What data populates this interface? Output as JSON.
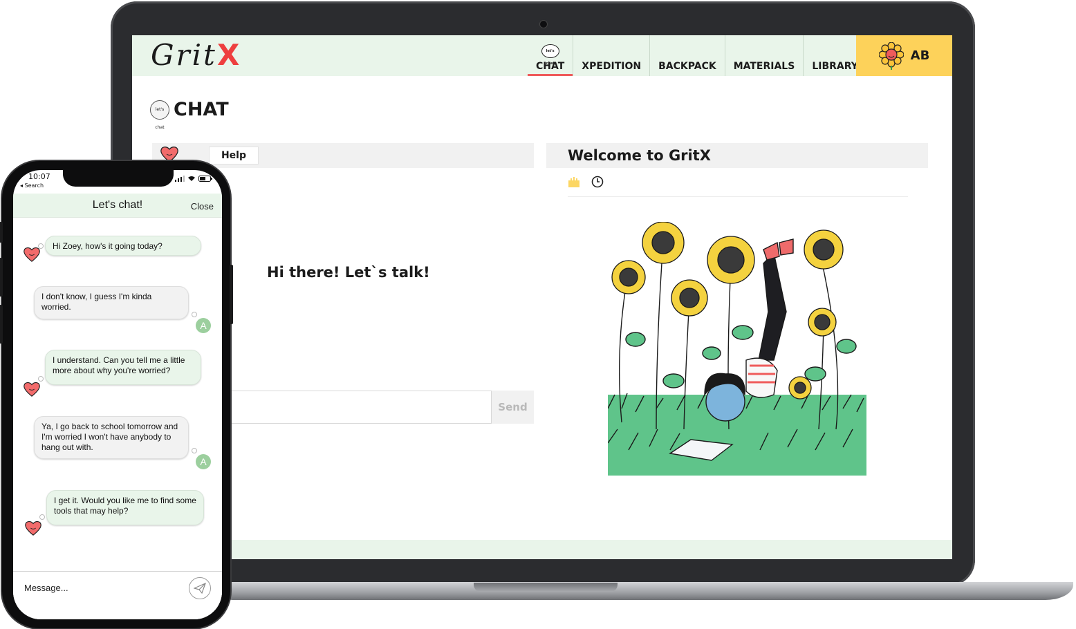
{
  "laptop": {
    "logo": {
      "text": "Grit",
      "accent": "X"
    },
    "nav": [
      {
        "label": "CHAT",
        "active": true
      },
      {
        "label": "XPEDITION",
        "active": false
      },
      {
        "label": "BACKPACK",
        "active": false
      },
      {
        "label": "MATERIALS",
        "active": false
      },
      {
        "label": "LIBRARY",
        "active": false
      }
    ],
    "nav_bubble_text": "let's chat",
    "user_initials": "AB",
    "page_title": "CHAT",
    "help_tab": "Help",
    "chat_greeting": "Hi there! Let`s talk!",
    "send_label": "Send",
    "welcome_title": "Welcome to GritX",
    "colors": {
      "header_bg": "#e9f5ea",
      "user_badge": "#fdd25a",
      "active_underline": "#ef5b5b",
      "logo_accent": "#ee3f3f"
    },
    "icons": [
      "flower-icon",
      "heart-icon",
      "clock-icon",
      "castle-icon",
      "speech-bubble-icon"
    ]
  },
  "phone": {
    "status_time": "10:07",
    "status_back": "◂ Search",
    "chat_title": "Let's chat!",
    "close_label": "Close",
    "messages": [
      {
        "from": "bot",
        "text": "Hi Zoey, how's it going today?"
      },
      {
        "from": "user",
        "text": "I don't know, I guess I'm kinda worried."
      },
      {
        "from": "bot",
        "text": "I understand. Can you tell me a little more about why you're worried?"
      },
      {
        "from": "user",
        "text": "Ya, I go back to school tomorrow and I'm worried I won't have anybody to hang out with."
      },
      {
        "from": "bot",
        "text": "I get it. Would you like me to find some tools that may help?"
      }
    ],
    "user_avatar_letter": "A",
    "composer_placeholder": "Message..."
  }
}
